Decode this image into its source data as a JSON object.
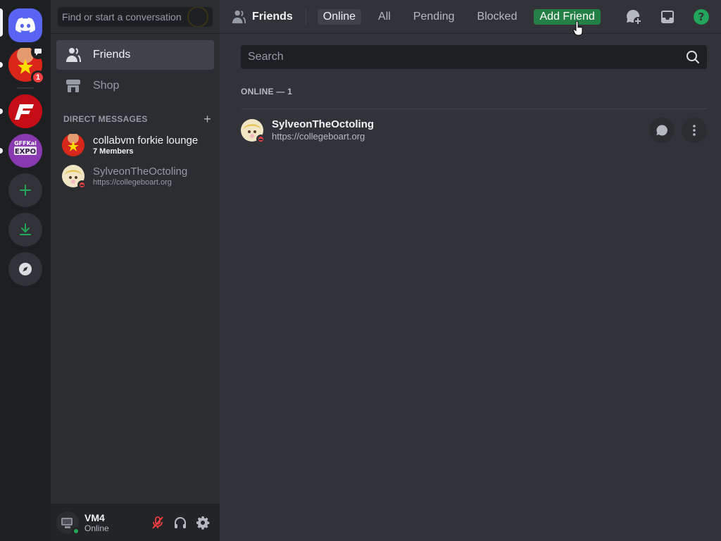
{
  "rail": {
    "servers": [
      {
        "name": "home",
        "unread_badge": "1"
      },
      {
        "name": "server-f"
      },
      {
        "name": "server-expo",
        "label": "GFFKai EXPO"
      }
    ]
  },
  "sidebar": {
    "search_placeholder": "Find or start a conversation",
    "nav": [
      {
        "label": "Friends",
        "icon": "friends-icon",
        "active": true
      },
      {
        "label": "Shop",
        "icon": "shop-icon"
      }
    ],
    "dm_header": "DIRECT MESSAGES",
    "dms": [
      {
        "name": "collabvm forkie lounge",
        "subtitle": "7 Members"
      },
      {
        "name": "SylveonTheOctoling",
        "subtitle": "https://collegeboart.org"
      }
    ]
  },
  "user": {
    "name": "VM4",
    "status": "Online"
  },
  "topbar": {
    "title": "Friends",
    "tabs": [
      "Online",
      "All",
      "Pending",
      "Blocked"
    ],
    "add_friend": "Add Friend"
  },
  "main": {
    "search_placeholder": "Search",
    "section_label": "ONLINE — 1",
    "friends": [
      {
        "name": "SylveonTheOctoling",
        "subtitle": "https://collegeboart.org"
      }
    ]
  },
  "colors": {
    "blurple": "#5865f2",
    "green": "#248046",
    "red": "#f23f42",
    "online": "#23a55a"
  }
}
